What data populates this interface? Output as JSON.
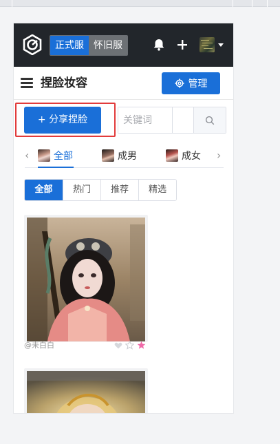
{
  "header": {
    "server_tabs": [
      {
        "label": "正式服",
        "active": true
      },
      {
        "label": "怀旧服",
        "active": false
      }
    ],
    "icons": [
      "logo-icon",
      "bell-icon",
      "plus-icon",
      "avatar",
      "chevron-down-icon"
    ]
  },
  "titlebar": {
    "title": "捏脸妆容",
    "manage_label": "管理"
  },
  "actions": {
    "share_label": "+ 分享捏脸",
    "search_placeholder": "关键词",
    "search_value": ""
  },
  "categories": [
    {
      "label": "全部",
      "active": true
    },
    {
      "label": "成男",
      "active": false
    },
    {
      "label": "成女",
      "active": false
    }
  ],
  "filters": [
    {
      "label": "全部",
      "active": true
    },
    {
      "label": "热门",
      "active": false
    },
    {
      "label": "推荐",
      "active": false
    },
    {
      "label": "精选",
      "active": false
    }
  ],
  "cards": [
    {
      "author": "@未白白"
    },
    {
      "author": ""
    }
  ],
  "colors": {
    "accent": "#1a6fd8",
    "header_bg": "#22262b",
    "highlight": "#e23b3b",
    "star_active": "#f06aa8"
  }
}
